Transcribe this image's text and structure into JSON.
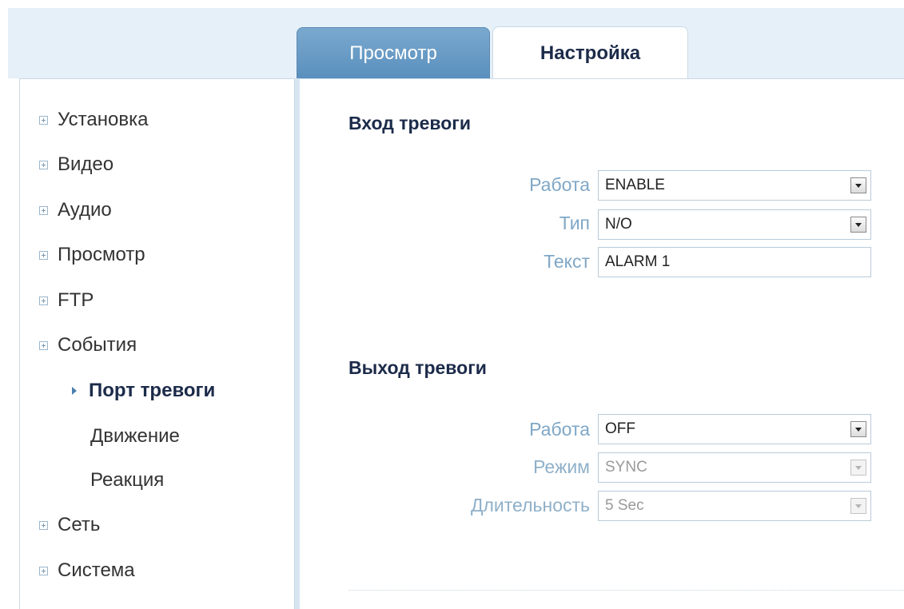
{
  "tabs": {
    "view_label": "Просмотр",
    "settings_label": "Настройка"
  },
  "sidebar": {
    "items": [
      {
        "label": "Установка"
      },
      {
        "label": "Видео"
      },
      {
        "label": "Аудио"
      },
      {
        "label": "Просмотр"
      },
      {
        "label": "FTP"
      },
      {
        "label": "События"
      },
      {
        "label": "Сеть"
      },
      {
        "label": "Система"
      }
    ],
    "events_subitems": [
      {
        "label": "Порт тревоги"
      },
      {
        "label": "Движение"
      },
      {
        "label": "Реакция"
      }
    ]
  },
  "alarm_input": {
    "title": "Вход тревоги",
    "operation_label": "Работа",
    "operation_value": "ENABLE",
    "type_label": "Тип",
    "type_value": "N/O",
    "text_label": "Текст",
    "text_value": "ALARM 1"
  },
  "alarm_output": {
    "title": "Выход тревоги",
    "operation_label": "Работа",
    "operation_value": "OFF",
    "mode_label": "Режим",
    "mode_value": "SYNC",
    "duration_label": "Длительность",
    "duration_value": "5 Sec"
  },
  "colors": {
    "accent": "#5a8fbd",
    "heading": "#1c2b4a",
    "label": "#7fa7c6",
    "band": "#e6f0f8"
  },
  "icons": {
    "tree_expand": "plus-box-icon",
    "active_marker": "triangle-right-icon",
    "dropdown": "chevron-down-icon"
  }
}
